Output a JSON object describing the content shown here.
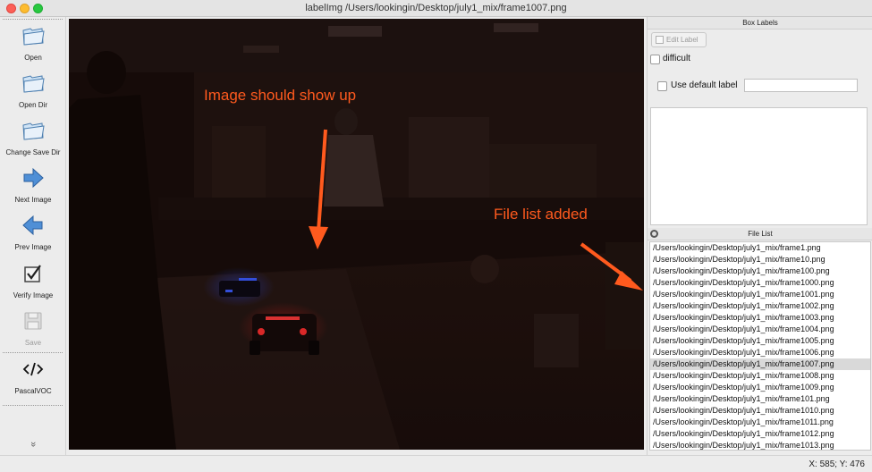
{
  "window": {
    "title": "labelImg /Users/lookingin/Desktop/july1_mix/frame1007.png"
  },
  "toolbar": {
    "items": [
      {
        "label": "Open",
        "icon": "folder-icon",
        "enabled": true
      },
      {
        "label": "Open Dir",
        "icon": "folder-icon",
        "enabled": true
      },
      {
        "label": "Change Save Dir",
        "icon": "folder-icon",
        "enabled": true
      },
      {
        "label": "Next Image",
        "icon": "arrow-right-icon",
        "enabled": true
      },
      {
        "label": "Prev Image",
        "icon": "arrow-left-icon",
        "enabled": true
      },
      {
        "label": "Verify Image",
        "icon": "checkbox-icon",
        "enabled": true
      },
      {
        "label": "Save",
        "icon": "floppy-icon",
        "enabled": false
      },
      {
        "label": "PascalVOC",
        "icon": "code-icon",
        "enabled": true
      }
    ],
    "more_glyph": "»"
  },
  "canvas": {
    "annotations": [
      {
        "text": "Image should show up"
      },
      {
        "text": "File list added"
      }
    ],
    "annotation_color": "#ff5a1e"
  },
  "box_labels": {
    "title": "Box Labels",
    "edit_label": "Edit Label",
    "difficult_label": "difficult",
    "use_default_label": "Use default label",
    "default_label_value": ""
  },
  "file_list": {
    "title": "File List",
    "selected_index": 10,
    "files": [
      "/Users/lookingin/Desktop/july1_mix/frame1.png",
      "/Users/lookingin/Desktop/july1_mix/frame10.png",
      "/Users/lookingin/Desktop/july1_mix/frame100.png",
      "/Users/lookingin/Desktop/july1_mix/frame1000.png",
      "/Users/lookingin/Desktop/july1_mix/frame1001.png",
      "/Users/lookingin/Desktop/july1_mix/frame1002.png",
      "/Users/lookingin/Desktop/july1_mix/frame1003.png",
      "/Users/lookingin/Desktop/july1_mix/frame1004.png",
      "/Users/lookingin/Desktop/july1_mix/frame1005.png",
      "/Users/lookingin/Desktop/july1_mix/frame1006.png",
      "/Users/lookingin/Desktop/july1_mix/frame1007.png",
      "/Users/lookingin/Desktop/july1_mix/frame1008.png",
      "/Users/lookingin/Desktop/july1_mix/frame1009.png",
      "/Users/lookingin/Desktop/july1_mix/frame101.png",
      "/Users/lookingin/Desktop/july1_mix/frame1010.png",
      "/Users/lookingin/Desktop/july1_mix/frame1011.png",
      "/Users/lookingin/Desktop/july1_mix/frame1012.png",
      "/Users/lookingin/Desktop/july1_mix/frame1013.png"
    ]
  },
  "status": {
    "text": "X: 585; Y: 476"
  }
}
